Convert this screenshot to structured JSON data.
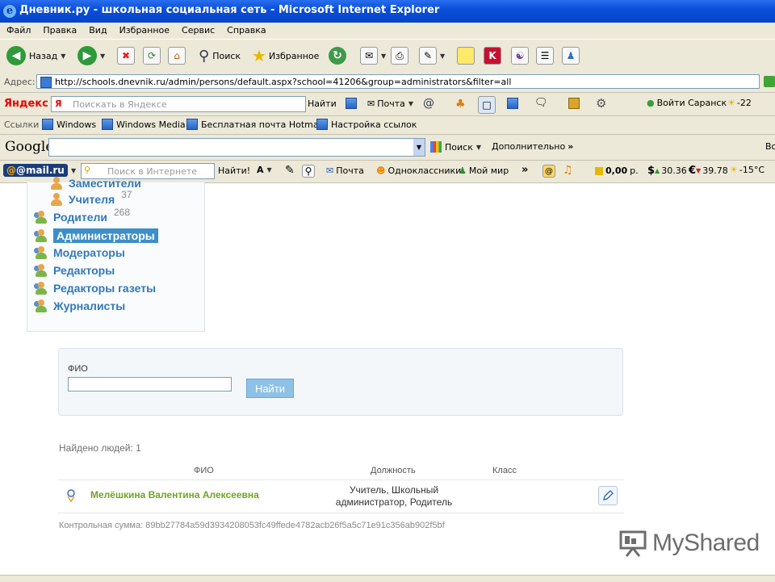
{
  "window": {
    "title": "Дневник.ру - школьная социальная сеть - Microsoft Internet Explorer"
  },
  "menu": [
    "Файл",
    "Правка",
    "Вид",
    "Избранное",
    "Сервис",
    "Справка"
  ],
  "toolbar": {
    "back": "Назад",
    "search": "Поиск",
    "favorites": "Избранное"
  },
  "address": {
    "label": "Адрес:",
    "url": "http://schools.dnevnik.ru/admin/persons/default.aspx?school=41206&group=administrators&filter=all"
  },
  "yandex": {
    "brand": "Яндекс",
    "placeholder": "Поискать в Яндексе",
    "find": "Найти",
    "mail": "Почта",
    "city": "Войти Саранск",
    "temp": "-22"
  },
  "links": {
    "label": "Ссылки",
    "items": [
      "Windows",
      "Windows Media",
      "Бесплатная почта Hotmail",
      "Настройка ссылок"
    ]
  },
  "google": {
    "brand": "Google",
    "search": "Поиск",
    "more": "Дополнительно",
    "extra": "Во"
  },
  "mailru": {
    "brand": "@mail.ru",
    "placeholder": "Поиск в Интернете",
    "find": "Найти!",
    "mail": "Почта",
    "ok": "Одноклассники",
    "world": "Мой мир",
    "money": "0,00",
    "money_unit": "р.",
    "usd": "30.36",
    "eur": "39.78",
    "weather": "-15°C"
  },
  "sidebar": {
    "items": [
      {
        "label": "Заместители",
        "count": ""
      },
      {
        "label": "Учителя",
        "count": "37"
      },
      {
        "label": "Родители",
        "count": "268"
      },
      {
        "label": "Администраторы",
        "count": ""
      },
      {
        "label": "Модераторы",
        "count": ""
      },
      {
        "label": "Редакторы",
        "count": ""
      },
      {
        "label": "Редакторы газеты",
        "count": ""
      },
      {
        "label": "Журналисты",
        "count": ""
      }
    ]
  },
  "search": {
    "field_label": "ФИО",
    "field_value": "",
    "button": "Найти"
  },
  "results": {
    "found": "Найдено людей: 1",
    "headers": {
      "name": "ФИО",
      "position": "Должность",
      "class": "Класс"
    },
    "rows": [
      {
        "name": "Мелёшкина Валентина Алексеевна",
        "position_line1": "Учитель, Школьный",
        "position_line2": "администратор, Родитель",
        "class": ""
      }
    ],
    "checksum": "Контрольная сумма: 89bb27784a59d3934208053fc49ffede4782acb26f5a5c71e91c356ab902f5bf"
  },
  "watermark": "MyShared"
}
